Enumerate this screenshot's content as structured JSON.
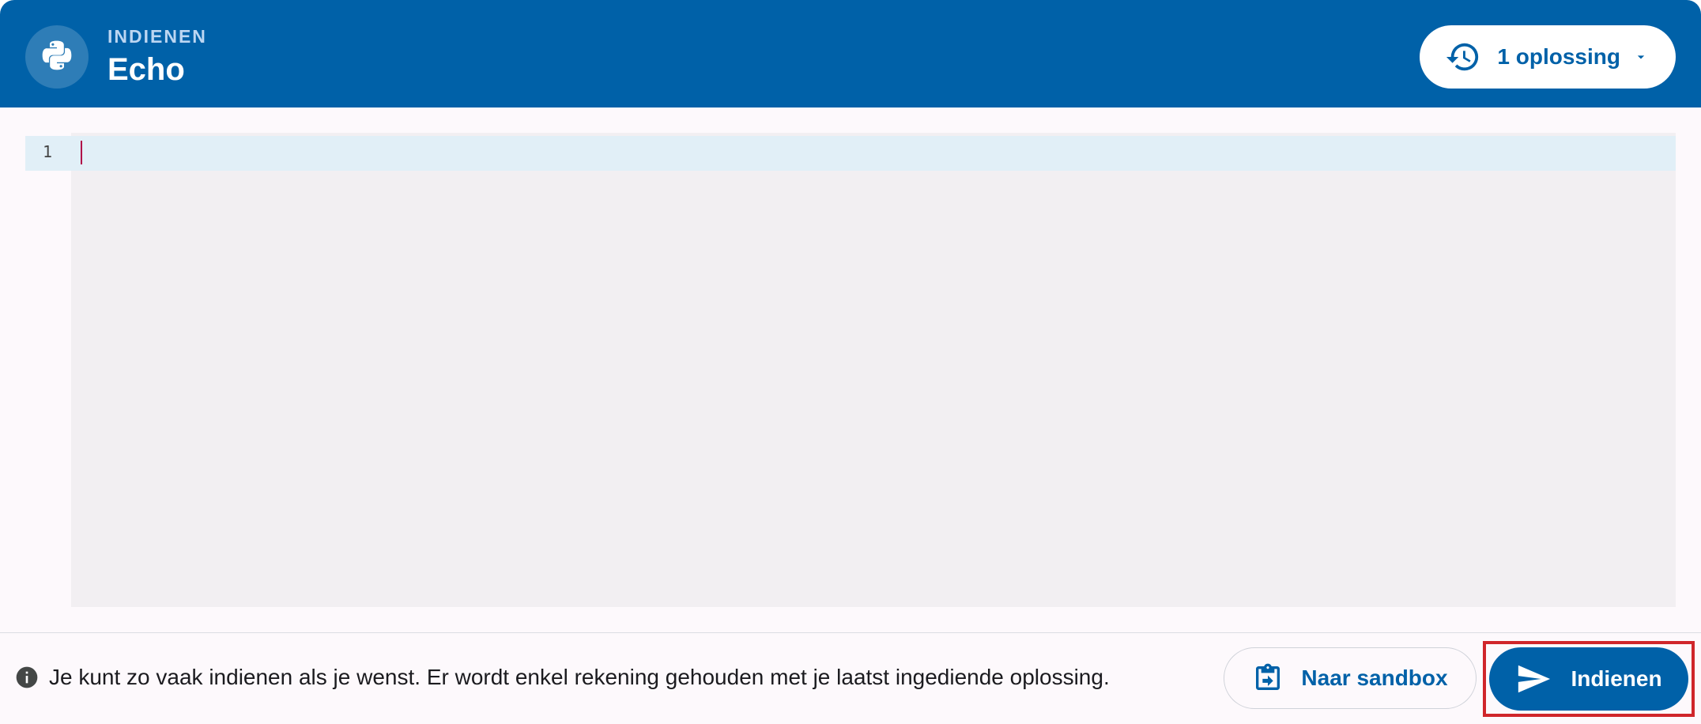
{
  "header": {
    "language_icon": "python-icon",
    "overline": "INDIENEN",
    "title": "Echo",
    "history_button": {
      "icon": "history-icon",
      "label": "1 oplossing",
      "caret_icon": "caret-down-icon"
    }
  },
  "editor": {
    "line_numbers": [
      "1"
    ],
    "content": ""
  },
  "footer": {
    "info_icon": "info-icon",
    "info_text": "Je kunt zo vaak indienen als je wenst. Er wordt enkel rekening gehouden met je laatst ingediende oplossing.",
    "sandbox_button": {
      "icon": "clipboard-arrow-icon",
      "label": "Naar sandbox"
    },
    "submit_button": {
      "icon": "send-icon",
      "label": "Indienen"
    }
  },
  "colors": {
    "primary": "#0061a8",
    "header_overline": "#bcd6f2",
    "active_line": "#e1eff7",
    "editor_background": "#f2eff2",
    "cursor": "#b00048",
    "highlight_border": "#d0262b"
  }
}
